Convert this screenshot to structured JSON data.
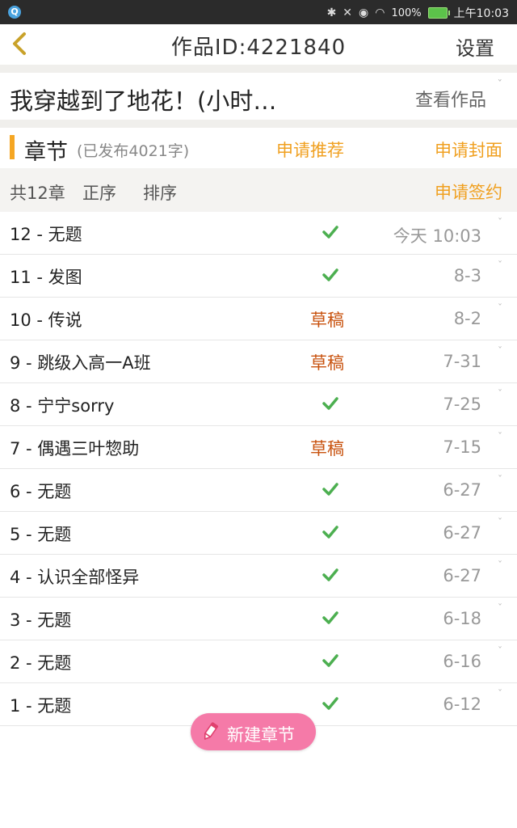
{
  "statusbar": {
    "battery_text": "100%",
    "time": "上午10:03",
    "app_icon": "Q"
  },
  "header": {
    "title": "作品ID:4221840",
    "settings_label": "设置"
  },
  "work": {
    "title": "我穿越到了地花！(小时…",
    "view_label": "查看作品"
  },
  "chapters_section": {
    "label": "章节",
    "published": "(已发布4021字)",
    "apply_recommend": "申请推荐",
    "apply_cover": "申请封面"
  },
  "filter": {
    "count": "共12章",
    "order_asc": "正序",
    "sort": "排序",
    "apply_contract": "申请签约"
  },
  "chapters": [
    {
      "name": "12 - 无题",
      "status": "published",
      "date": "今天 10:03"
    },
    {
      "name": "11 - 发图",
      "status": "published",
      "date": "8-3"
    },
    {
      "name": "10 - 传说",
      "status": "草稿",
      "date": "8-2"
    },
    {
      "name": "9 - 跳级入高一A班",
      "status": "草稿",
      "date": "7-31"
    },
    {
      "name": "8 - 宁宁sorry",
      "status": "published",
      "date": "7-25"
    },
    {
      "name": "7 - 偶遇三叶惣助",
      "status": "草稿",
      "date": "7-15"
    },
    {
      "name": "6 - 无题",
      "status": "published",
      "date": "6-27"
    },
    {
      "name": "5 - 无题",
      "status": "published",
      "date": "6-27"
    },
    {
      "name": "4 - 认识全部怪异",
      "status": "published",
      "date": "6-27"
    },
    {
      "name": "3 - 无题",
      "status": "published",
      "date": "6-18"
    },
    {
      "name": "2 - 无题",
      "status": "published",
      "date": "6-16"
    },
    {
      "name": "1 - 无题",
      "status": "published",
      "date": "6-12"
    }
  ],
  "fab": {
    "label": "新建章节"
  },
  "colors": {
    "accent_orange": "#f0a020",
    "draft_red": "#c8520e",
    "check_green": "#4caf50",
    "fab_pink": "#f57aa8"
  },
  "icons": [
    "back-chevron-icon",
    "bluetooth-icon",
    "mute-icon",
    "eye-icon",
    "wifi-icon",
    "battery-icon",
    "check-icon",
    "caret-icon",
    "pencil-icon"
  ]
}
